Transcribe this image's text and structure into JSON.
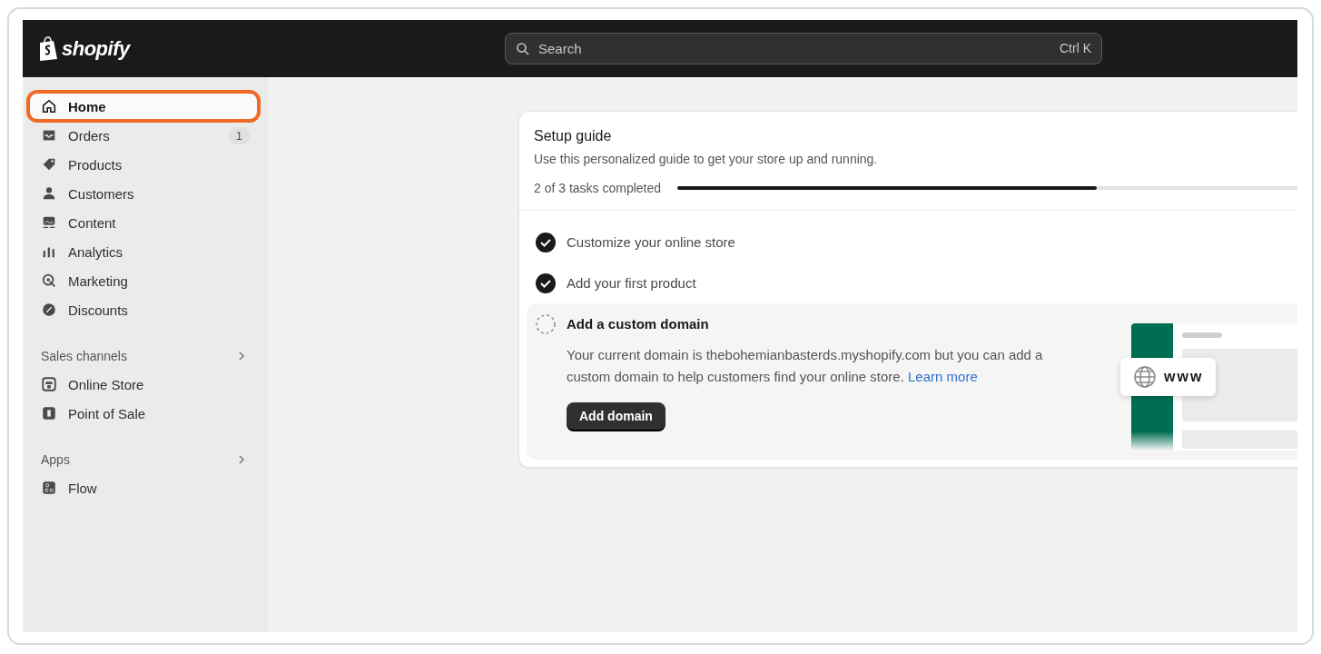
{
  "topbar": {
    "logo": "shopify",
    "search": {
      "placeholder": "Search",
      "shortcut": "Ctrl K"
    }
  },
  "sidebar": {
    "items": [
      {
        "label": "Home",
        "kind": "home",
        "selected": true,
        "highlighted": true
      },
      {
        "label": "Orders",
        "kind": "inbox",
        "selected": false,
        "badge": "1"
      },
      {
        "label": "Products",
        "kind": "tag",
        "selected": false
      },
      {
        "label": "Customers",
        "kind": "person",
        "selected": false
      },
      {
        "label": "Content",
        "kind": "content",
        "selected": false
      },
      {
        "label": "Analytics",
        "kind": "bars",
        "selected": false
      },
      {
        "label": "Marketing",
        "kind": "target",
        "selected": false
      },
      {
        "label": "Discounts",
        "kind": "discount",
        "selected": false
      }
    ],
    "sections": [
      {
        "title": "Sales channels",
        "items": [
          {
            "label": "Online Store",
            "kind": "store",
            "selected": false
          },
          {
            "label": "Point of Sale",
            "kind": "pos",
            "selected": false
          }
        ]
      },
      {
        "title": "Apps",
        "items": [
          {
            "label": "Flow",
            "kind": "flow",
            "selected": false
          }
        ]
      }
    ]
  },
  "setup_guide": {
    "title": "Setup guide",
    "subtitle": "Use this personalized guide to get your store up and running.",
    "progress_text": "2 of 3 tasks completed",
    "level": 0.67,
    "tasks": [
      {
        "label": "Customize your online store",
        "completed": true,
        "expanded": false
      },
      {
        "label": "Add your first product",
        "completed": true,
        "expanded": false
      },
      {
        "label": "Add a custom domain",
        "completed": false,
        "expanded": true,
        "description": "Your current domain is thebohemianbasterds.myshopify.com but you can add a custom domain to help customers find your online store.",
        "link": "Learn more",
        "button": "Add domain",
        "illustration_text": "www"
      }
    ]
  }
}
